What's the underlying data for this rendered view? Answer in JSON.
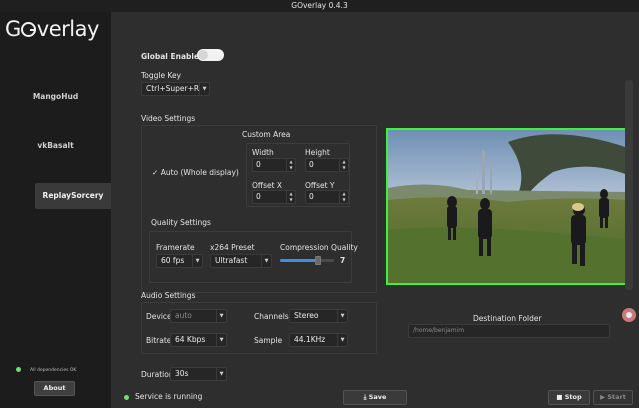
{
  "window": {
    "title": "GOverlay 0.4.3"
  },
  "logo": {
    "text": "verlay"
  },
  "sidebar": {
    "items": [
      {
        "label": "MangoHud"
      },
      {
        "label": "vkBasalt"
      },
      {
        "label": "ReplaySorcery",
        "selected": true
      }
    ],
    "deps_status": "All dependencies OK",
    "about_label": "About"
  },
  "general": {
    "global_enable_label": "Global Enable",
    "global_enable_on": true,
    "toggle_key_label": "Toggle Key",
    "toggle_key_value": "Ctrl+Super+R"
  },
  "video": {
    "title": "Video Settings",
    "custom_area_title": "Custom Area",
    "auto_label": "Auto (Whole display)",
    "auto_checked": true,
    "width_label": "Width",
    "width_value": "0",
    "height_label": "Height",
    "height_value": "0",
    "offset_x_label": "Offset X",
    "offset_x_value": "0",
    "offset_y_label": "Offset Y",
    "offset_y_value": "0"
  },
  "quality": {
    "title": "Quality Settings",
    "framerate_label": "Framerate",
    "framerate_value": "60 fps",
    "preset_label": "x264 Preset",
    "preset_value": "Ultrafast",
    "compression_label": "Compression Quality",
    "compression_value": "7",
    "compression_fraction": 0.7
  },
  "audio": {
    "title": "Audio Settings",
    "device_label": "Device",
    "device_value": "auto",
    "channels_label": "Channels",
    "channels_value": "Stereo",
    "bitrate_label": "Bitrate",
    "bitrate_value": "64 Kbps",
    "sample_label": "Sample",
    "sample_value": "44.1KHz"
  },
  "destination": {
    "label": "Destination Folder",
    "value": "/home/benjamim"
  },
  "duration": {
    "label": "Duration",
    "value": "30s"
  },
  "footer": {
    "status": "Service is running",
    "save_label": "Save",
    "stop_label": "Stop",
    "start_label": "Start"
  },
  "colors": {
    "accent": "#3d8ee6",
    "preview_border": "#3cf23c",
    "status_ok": "#6ee06e"
  }
}
